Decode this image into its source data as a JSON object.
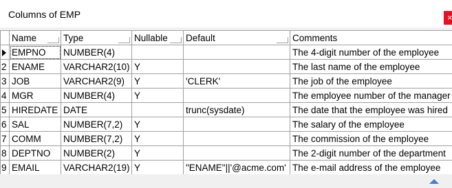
{
  "window": {
    "title": "Columns of EMP",
    "close_label": "×"
  },
  "table": {
    "headers": [
      "Name",
      "Type",
      "Nullable",
      "Default",
      "Comments"
    ],
    "rows": [
      {
        "idx": "",
        "name": "EMPNO",
        "type": "NUMBER(4)",
        "nullable": "",
        "default": "",
        "comments": "The 4-digit number of the employee"
      },
      {
        "idx": "2",
        "name": "ENAME",
        "type": "VARCHAR2(10)",
        "nullable": "Y",
        "default": "",
        "comments": "The last name of the employee"
      },
      {
        "idx": "3",
        "name": "JOB",
        "type": "VARCHAR2(9)",
        "nullable": "Y",
        "default": "'CLERK'",
        "comments": "The job of the employee"
      },
      {
        "idx": "4",
        "name": "MGR",
        "type": "NUMBER(4)",
        "nullable": "Y",
        "default": "",
        "comments": "The employee number of the manager"
      },
      {
        "idx": "5",
        "name": "HIREDATE",
        "type": "DATE",
        "nullable": "",
        "default": "trunc(sysdate)",
        "comments": "The date that the employee was hired"
      },
      {
        "idx": "6",
        "name": "SAL",
        "type": "NUMBER(7,2)",
        "nullable": "Y",
        "default": "",
        "comments": "The salary of the employee"
      },
      {
        "idx": "7",
        "name": "COMM",
        "type": "NUMBER(7,2)",
        "nullable": "Y",
        "default": "",
        "comments": "The commission of the employee"
      },
      {
        "idx": "8",
        "name": "DEPTNO",
        "type": "NUMBER(2)",
        "nullable": "Y",
        "default": "",
        "comments": "The 2-digit number of the department"
      },
      {
        "idx": "9",
        "name": "EMAIL",
        "type": "VARCHAR2(19)",
        "nullable": "Y",
        "default": "\"ENAME\"||'@acme.com'",
        "comments": "The e-mail address of the employee"
      }
    ]
  },
  "icons": {
    "current_row": "row-pointer-icon",
    "scroll": "scroll-up-icon"
  },
  "colors": {
    "close": "#e81123",
    "scroll_arrow": "#4a7fc1",
    "grid_line": "#a0a0a0"
  }
}
